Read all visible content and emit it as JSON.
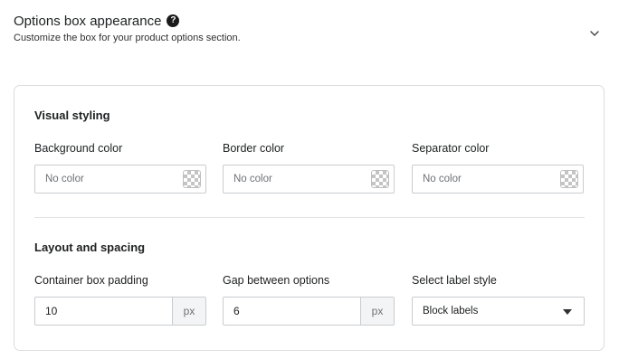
{
  "header": {
    "title": "Options box appearance",
    "help_icon": "?",
    "subtitle": "Customize the box for your product options section."
  },
  "visual_styling": {
    "title": "Visual styling",
    "fields": [
      {
        "label": "Background color",
        "placeholder": "No color"
      },
      {
        "label": "Border color",
        "placeholder": "No color"
      },
      {
        "label": "Separator color",
        "placeholder": "No color"
      }
    ]
  },
  "layout_spacing": {
    "title": "Layout and spacing",
    "padding": {
      "label": "Container box padding",
      "value": "10",
      "unit": "px"
    },
    "gap": {
      "label": "Gap between options",
      "value": "6",
      "unit": "px"
    },
    "label_style": {
      "label": "Select label style",
      "selected": "Block labels"
    }
  },
  "icons": {
    "help": "question-circle-icon",
    "collapse": "chevron-down-icon",
    "swatch": "checkerboard-swatch-icon",
    "select": "caret-down-icon"
  }
}
